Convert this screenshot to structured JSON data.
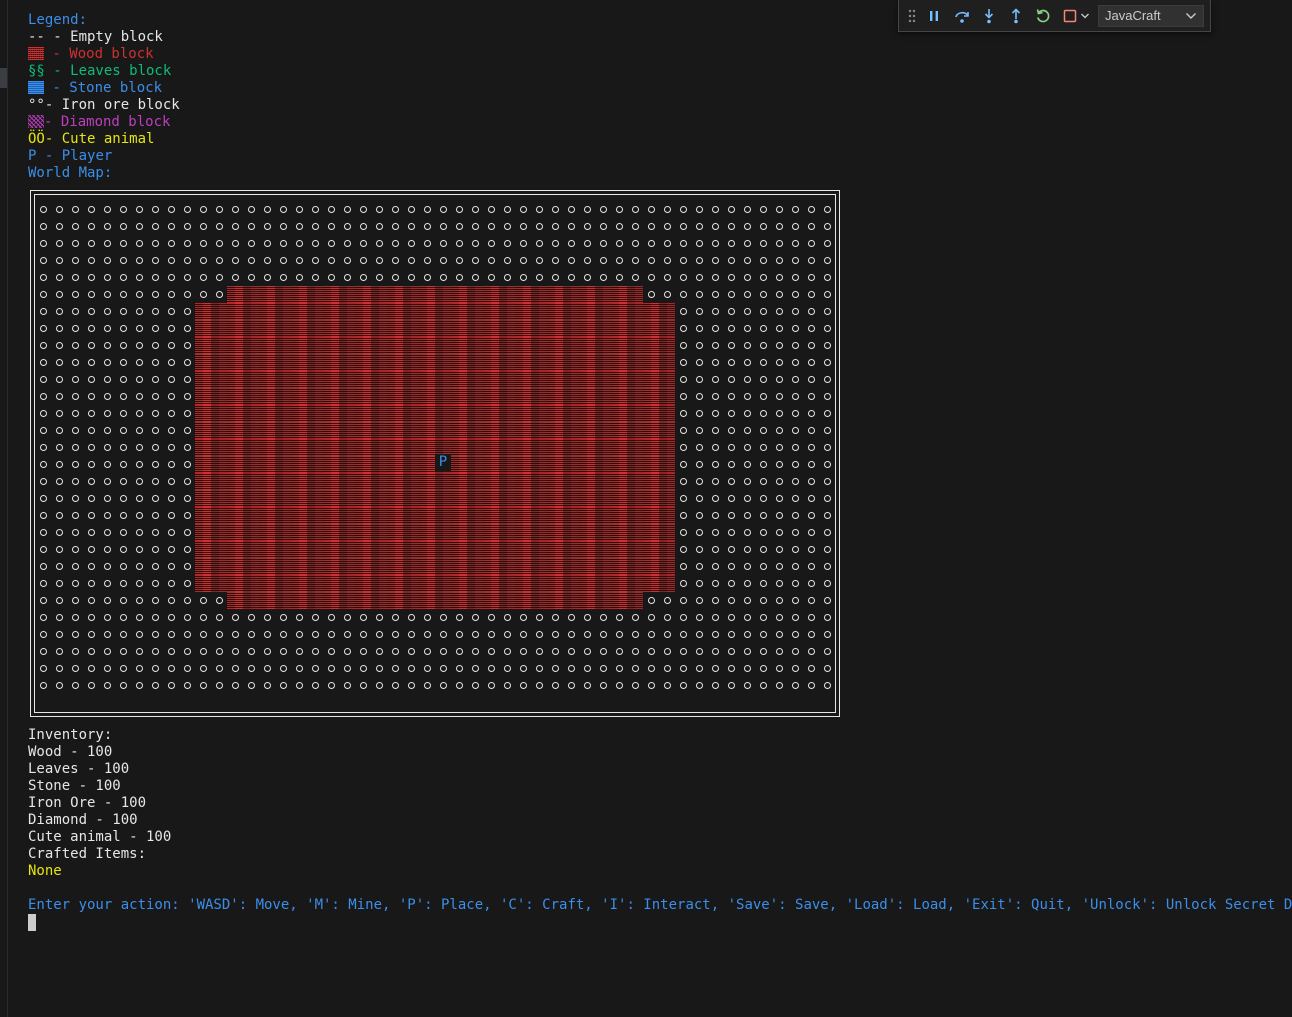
{
  "legend": {
    "title": "Legend:",
    "items": [
      {
        "symbol": "--",
        "label": " - Empty block",
        "color": "#e6e6e6"
      },
      {
        "symbol": "wood-symbol",
        "label": " - Wood block",
        "color": "#cd3131"
      },
      {
        "symbol": "§§",
        "label": " - Leaves block",
        "color": "#0dbc79"
      },
      {
        "symbol": "stone-symbol",
        "label": " - Stone block",
        "color": "#3b8eea"
      },
      {
        "symbol": "°°",
        "label": "- Iron ore block",
        "color": "#e6e6e6"
      },
      {
        "symbol": "diamond-symbol",
        "label": "- Diamond block",
        "color": "#bc3fbc"
      },
      {
        "symbol": "ÖÖ",
        "label": "- Cute animal",
        "color": "#e5e510"
      },
      {
        "symbol": "P",
        "label": " - Player",
        "color": "#3b8eea"
      }
    ],
    "map_title": "World Map:"
  },
  "map": {
    "cols": 50,
    "rows": 29,
    "player_symbol": "P",
    "player_col": 25,
    "player_row": 15
  },
  "inventory": {
    "title": "Inventory:",
    "items": [
      "Wood - 100",
      "Leaves - 100",
      "Stone - 100",
      "Iron Ore - 100",
      "Diamond - 100",
      "Cute animal - 100"
    ],
    "crafted_title": "Crafted Items:",
    "crafted_value": "None"
  },
  "prompt": "Enter your action: 'WASD': Move, 'M': Mine, 'P': Place, 'C': Craft, 'I': Interact, 'Save': Save, 'Load': Load, 'Exit': Quit, 'Unlock': Unlock Secret Door",
  "debug_toolbar": {
    "target": "JavaCraft",
    "colors": {
      "pause": "#75beff",
      "step": "#75beff",
      "restart": "#89d185",
      "stop": "#f48771"
    }
  }
}
